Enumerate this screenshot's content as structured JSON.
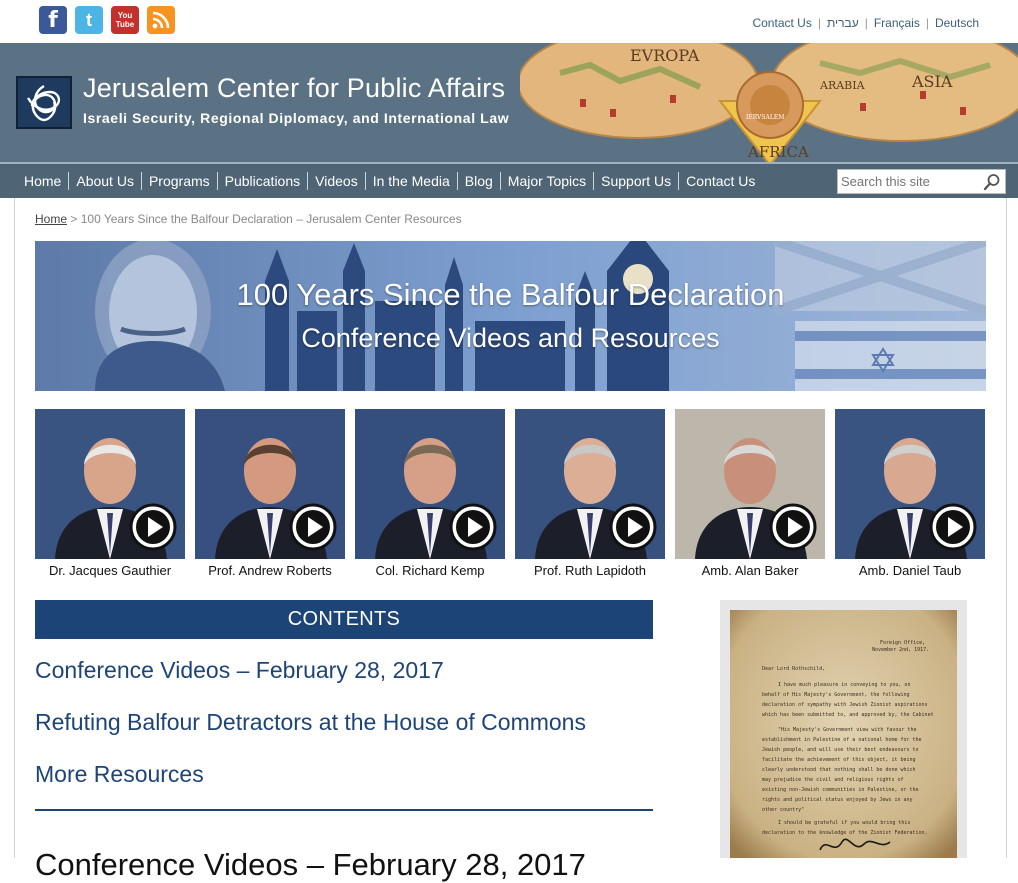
{
  "social": {
    "facebook": "f",
    "twitter": "t",
    "youtube_top": "You",
    "youtube_bottom": "Tube"
  },
  "languages": [
    "Contact Us",
    "עברית",
    "Français",
    "Deutsch"
  ],
  "header": {
    "title": "Jerusalem Center for Public Affairs",
    "tagline": "Israeli Security, Regional Diplomacy, and International Law",
    "map_labels": [
      "EVROPA",
      "ASIA",
      "AFRICA",
      "ARABIA",
      "IERVSALEM"
    ]
  },
  "nav": {
    "items": [
      "Home",
      "About Us",
      "Programs",
      "Publications",
      "Videos",
      "In the Media",
      "Blog",
      "Major Topics",
      "Support Us",
      "Contact Us"
    ],
    "search_placeholder": "Search this site"
  },
  "breadcrumb": {
    "home": "Home",
    "separator": ">",
    "current": "100 Years Since the Balfour Declaration – Jerusalem Center Resources"
  },
  "banner": {
    "title": "100 Years Since the Balfour Declaration",
    "subtitle": "Conference Videos and Resources"
  },
  "speakers": [
    {
      "name": "Dr. Jacques Gauthier",
      "tone": "#2e4a7a",
      "hair": "#e8e8e8",
      "skin": "#d8a48a"
    },
    {
      "name": "Prof. Andrew Roberts",
      "tone": "#2b4677",
      "hair": "#5a4030",
      "skin": "#d49a80"
    },
    {
      "name": "Col. Richard Kemp",
      "tone": "#284476",
      "hair": "#7a6a55",
      "skin": "#d6a088"
    },
    {
      "name": "Prof. Ruth Lapidoth",
      "tone": "#2c4878",
      "hair": "#c8c8c8",
      "skin": "#dcae96"
    },
    {
      "name": "Amb. Alan Baker",
      "tone": "#b8b2a6",
      "hair": "#d8d8d8",
      "skin": "#c8907a"
    },
    {
      "name": "Amb. Daniel Taub",
      "tone": "#2e4a7a",
      "hair": "#d0d0d0",
      "skin": "#d8a890"
    }
  ],
  "contents": {
    "heading": "CONTENTS",
    "items": [
      "Conference Videos – February 28, 2017",
      "Refuting Balfour Detractors at the House of Commons",
      "More Resources"
    ]
  },
  "section_heading": "Conference Videos – February 28, 2017",
  "letter": {
    "office": "Foreign Office,",
    "date": "November 2nd, 1917.",
    "salutation": "Dear Lord Rothschild,",
    "lines": [
      "I have much pleasure in conveying to you, on",
      "behalf of His Majesty's Government, the following",
      "declaration of sympathy with Jewish Zionist aspirations",
      "which has been submitted to, and approved by, the Cabinet",
      "\"His Majesty's Government view with favour the",
      "establishment in Palestine of a national home for the",
      "Jewish people, and will use their best endeavours to",
      "facilitate the achievement of this object, it being",
      "clearly understood that nothing shall be done which",
      "may prejudice the civil and religious rights of",
      "existing non-Jewish communities in Palestine, or the",
      "rights and political status enjoyed by Jews in any",
      "other country\"",
      "I should be grateful if you would bring this",
      "declaration to the knowledge of the Zionist Federation."
    ]
  },
  "colors": {
    "navy": "#1d4477",
    "header_slate": "#5b7285",
    "nav_slate": "#4f6576"
  }
}
